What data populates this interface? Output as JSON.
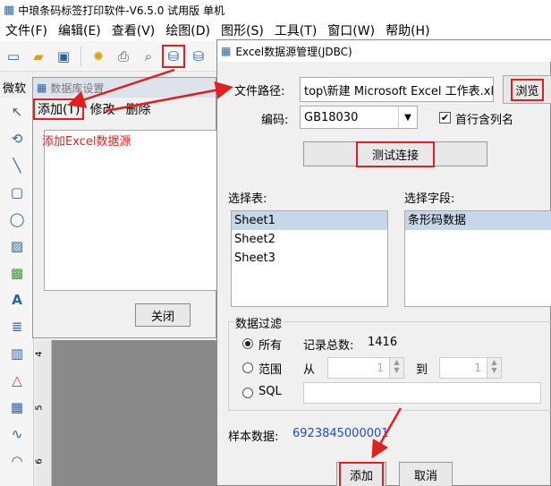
{
  "app": {
    "title": "中琅条码标签打印软件-V6.5.0 试用版 单机",
    "menu": [
      "文件(F)",
      "编辑(E)",
      "查看(V)",
      "绘图(D)",
      "图形(S)",
      "工具(T)",
      "窗口(W)",
      "帮助(H)"
    ],
    "left_label": "微软",
    "ruler_ticks": [
      "4",
      "5",
      "6"
    ]
  },
  "db_dialog": {
    "title": "数据库设置",
    "menu": [
      "添加(T)",
      "修改",
      "删除"
    ],
    "hint": "添加Excel数据源",
    "close_label": "关闭"
  },
  "excel_dialog": {
    "title": "Excel数据源管理(JDBC)",
    "file_path_label": "文件路径:",
    "file_path_value": "top\\新建 Microsoft Excel 工作表.xls",
    "browse_label": "浏览",
    "encoding_label": "编码:",
    "encoding_value": "GB18030",
    "first_row_header_label": "首行含列名",
    "first_row_header_checked": true,
    "test_button_label": "测试连接",
    "select_table_label": "选择表:",
    "tables": [
      "Sheet1",
      "Sheet2",
      "Sheet3"
    ],
    "selected_table": "Sheet1",
    "select_field_label": "选择字段:",
    "fields": [
      "条形码数据"
    ],
    "filter_group_label": "数据过滤",
    "filter_all_label": "所有",
    "record_count_label": "记录总数:",
    "record_count_value": "1416",
    "filter_range_label": "范围",
    "range_from_label": "从",
    "range_from_value": "1",
    "range_to_label": "到",
    "range_to_value": "1",
    "filter_sql_label": "SQL",
    "sample_label": "样本数据:",
    "sample_value": "6923845000001",
    "add_label": "添加",
    "cancel_label": "取消"
  },
  "colors": {
    "highlight": "#e02020",
    "sample_text": "#1a4fbf",
    "selection": "#c7d7ea"
  }
}
